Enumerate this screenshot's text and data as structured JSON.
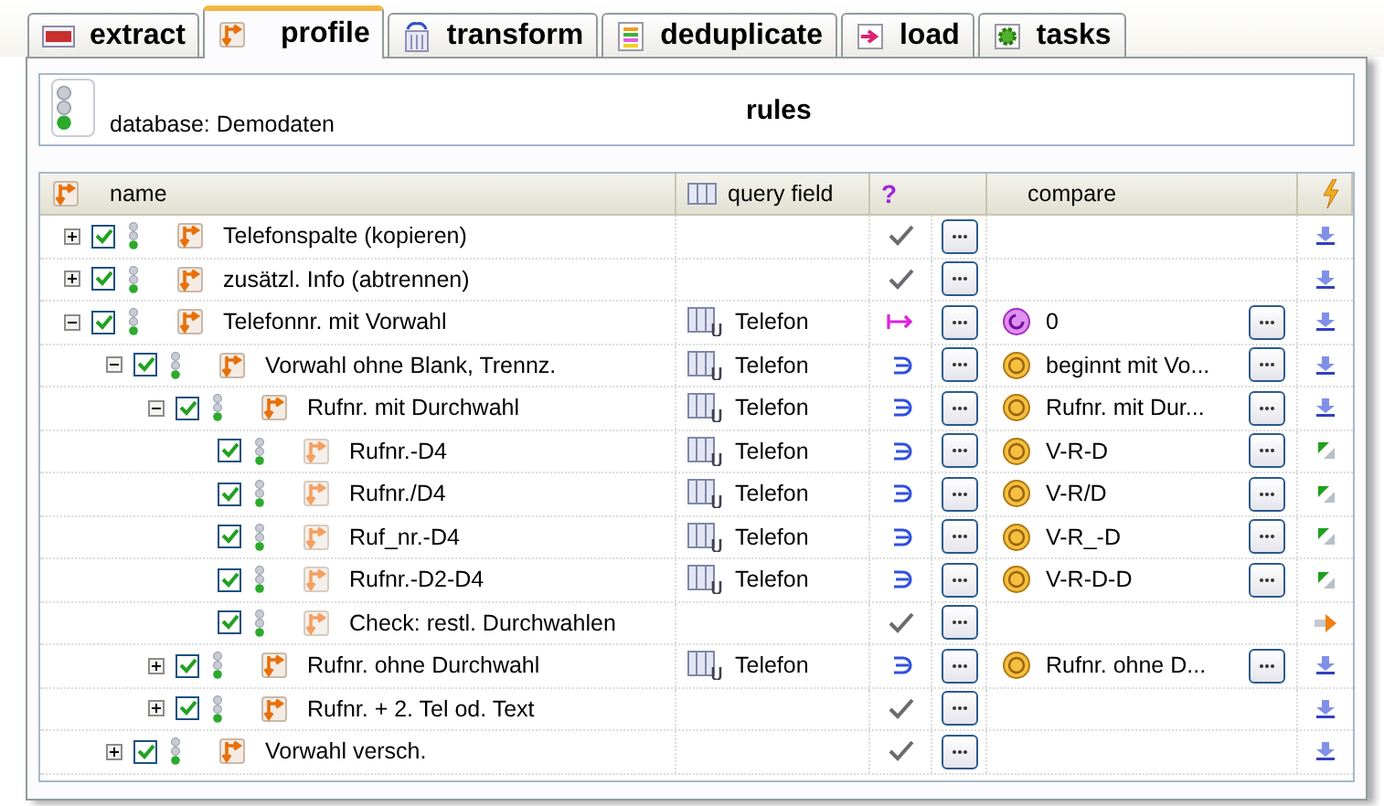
{
  "tabs": [
    {
      "label": "extract",
      "kind": "sql",
      "selected": false
    },
    {
      "label": "profile",
      "kind": "profile",
      "selected": true
    },
    {
      "label": "transform",
      "kind": "transform",
      "selected": false
    },
    {
      "label": "deduplicate",
      "kind": "dedup",
      "selected": false
    },
    {
      "label": "load",
      "kind": "load",
      "selected": false
    },
    {
      "label": "tasks",
      "kind": "tasks",
      "selected": false
    }
  ],
  "database": "database: Demodaten",
  "title": "rules",
  "columns": {
    "name": "name",
    "query_field": "query field",
    "op": "?",
    "compare": "compare"
  },
  "rows": [
    {
      "name": "Telefonspalte (kopieren)",
      "expanded": false,
      "checked": true,
      "op": {
        "kind": "check"
      },
      "action": {
        "kind": "down"
      }
    },
    {
      "name": "zusätzl. Info (abtrennen)",
      "expanded": false,
      "checked": true,
      "op": {
        "kind": "check"
      },
      "action": {
        "kind": "down"
      }
    },
    {
      "name": "Telefonnr. mit Vorwahl",
      "expanded": true,
      "checked": true,
      "query_field": "Telefon",
      "op": {
        "kind": "assign"
      },
      "compare": {
        "kind": "constant",
        "text": "0"
      },
      "action": {
        "kind": "down"
      },
      "children": [
        {
          "name": "Vorwahl ohne Blank, Trennz.",
          "expanded": true,
          "checked": true,
          "query_field": "Telefon",
          "op": {
            "kind": "contains"
          },
          "compare": {
            "kind": "string",
            "text": "beginnt mit Vo..."
          },
          "action": {
            "kind": "down"
          },
          "children": [
            {
              "name": "Rufnr. mit Durchwahl",
              "expanded": true,
              "checked": true,
              "query_field": "Telefon",
              "op": {
                "kind": "contains"
              },
              "compare": {
                "kind": "string",
                "text": "Rufnr. mit Dur..."
              },
              "action": {
                "kind": "down"
              },
              "children": [
                {
                  "name": "Rufnr.-D4",
                  "checked": true,
                  "query_field": "Telefon",
                  "op": {
                    "kind": "contains"
                  },
                  "compare": {
                    "kind": "string",
                    "text": "V-R-D"
                  },
                  "action": {
                    "kind": "green"
                  }
                },
                {
                  "name": "Rufnr./D4",
                  "checked": true,
                  "query_field": "Telefon",
                  "op": {
                    "kind": "contains"
                  },
                  "compare": {
                    "kind": "string",
                    "text": "V-R/D"
                  },
                  "action": {
                    "kind": "green"
                  }
                },
                {
                  "name": "Ruf_nr.-D4",
                  "checked": true,
                  "query_field": "Telefon",
                  "op": {
                    "kind": "contains"
                  },
                  "compare": {
                    "kind": "string",
                    "text": "V-R_-D"
                  },
                  "action": {
                    "kind": "green"
                  }
                },
                {
                  "name": "Rufnr.-D2-D4",
                  "checked": true,
                  "query_field": "Telefon",
                  "op": {
                    "kind": "contains"
                  },
                  "compare": {
                    "kind": "string",
                    "text": "V-R-D-D"
                  },
                  "action": {
                    "kind": "green"
                  }
                },
                {
                  "name": "Check: restl. Durchwahlen",
                  "checked": true,
                  "op": {
                    "kind": "check"
                  },
                  "action": {
                    "kind": "orange"
                  }
                }
              ]
            },
            {
              "name": "Rufnr. ohne Durchwahl",
              "expanded": false,
              "checked": true,
              "query_field": "Telefon",
              "op": {
                "kind": "contains"
              },
              "compare": {
                "kind": "string",
                "text": "Rufnr. ohne D..."
              },
              "action": {
                "kind": "down"
              }
            },
            {
              "name": "Rufnr. + 2. Tel od. Text",
              "expanded": false,
              "checked": true,
              "op": {
                "kind": "check"
              },
              "action": {
                "kind": "down"
              }
            }
          ]
        },
        {
          "name": "Vorwahl versch.",
          "expanded": false,
          "checked": true,
          "op": {
            "kind": "check"
          },
          "action": {
            "kind": "down"
          }
        }
      ]
    }
  ]
}
